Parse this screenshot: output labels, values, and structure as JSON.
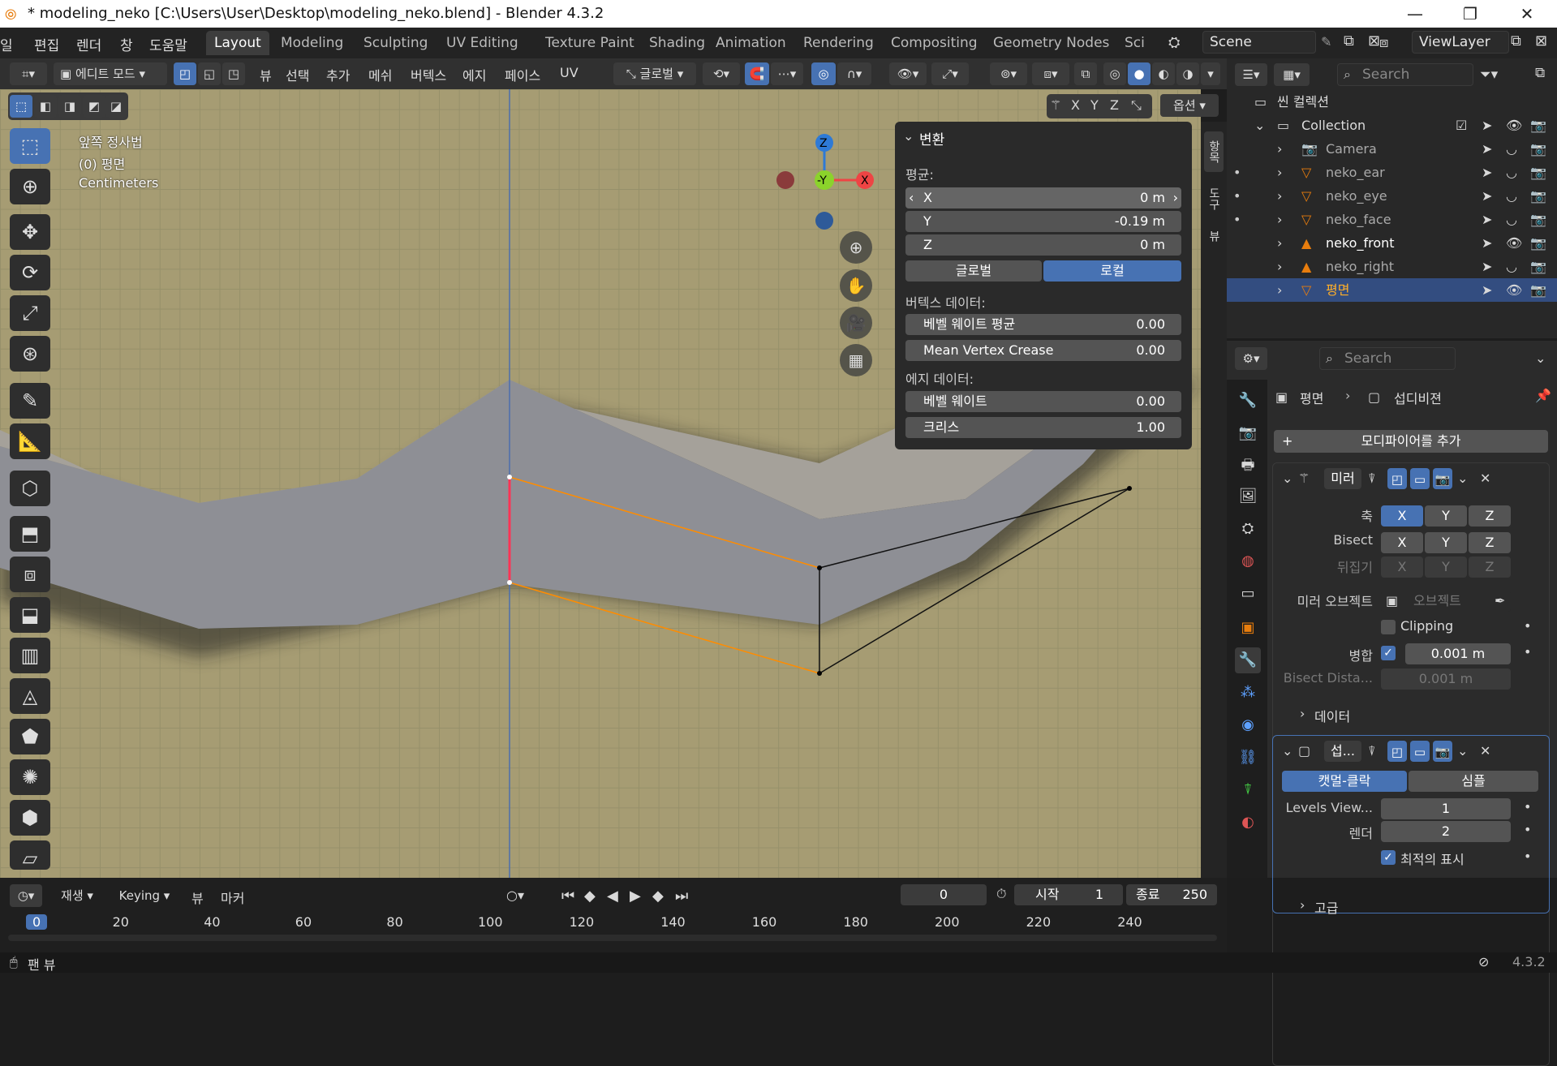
{
  "titlebar": {
    "title": "* modeling_neko [C:\\Users\\User\\Desktop\\modeling_neko.blend] - Blender 4.3.2",
    "minimize": "—",
    "maximize": "❐",
    "close": "✕"
  },
  "menus": [
    "일",
    "편집",
    "렌더",
    "창",
    "도움말"
  ],
  "menus_left": [
    0,
    42,
    94,
    148,
    184
  ],
  "workspaces": [
    "Layout",
    "Modeling",
    "Sculpting",
    "UV Editing",
    "Texture Paint",
    "Shading",
    "Animation",
    "Rendering",
    "Compositing",
    "Geometry Nodes",
    "Sci"
  ],
  "scene": "Scene",
  "view_layer": "ViewLayer",
  "vp_header": {
    "mode": "에디트 모드",
    "menus": [
      "뷰",
      "선택",
      "추가",
      "메쉬",
      "버텍스",
      "에지",
      "페이스",
      "UV"
    ],
    "orientation": "글로벌",
    "options": "옵션",
    "axes": [
      "X",
      "Y",
      "Z"
    ]
  },
  "overlay": {
    "view_name": "앞쪽 정사법",
    "object": "(0) 평면",
    "units": "Centimeters"
  },
  "gizmo": {
    "z": "Z",
    "y": "-Y",
    "x": "X"
  },
  "npanel": {
    "title": "변환",
    "median": "평균:",
    "x_label": "X",
    "x_value": "0 m",
    "y_label": "Y",
    "y_value": "-0.19 m",
    "z_label": "Z",
    "z_value": "0 m",
    "global": "글로벌",
    "local": "로컬",
    "vertex_data": "버텍스 데이터:",
    "bevel_weight_mean": "베벨 웨이트 평균",
    "bevel_weight_mean_value": "0.00",
    "mean_crease": "Mean Vertex Crease",
    "mean_crease_value": "0.00",
    "edge_data": "에지 데이터:",
    "bevel_weight": "베벨 웨이트",
    "bevel_weight_value": "0.00",
    "crease": "크리스",
    "crease_value": "1.00",
    "side_tabs": [
      "항목",
      "도구",
      "뷰"
    ]
  },
  "outliner": {
    "search_placeholder": "Search",
    "scene_collection": "씬 컬렉션",
    "collection": "Collection",
    "items": [
      {
        "name": "Camera",
        "color": "#aaaaaa"
      },
      {
        "name": "neko_ear",
        "color": "#aaaaaa"
      },
      {
        "name": "neko_eye",
        "color": "#aaaaaa"
      },
      {
        "name": "neko_face",
        "color": "#aaaaaa"
      },
      {
        "name": "neko_front",
        "color": "#ffffff"
      },
      {
        "name": "neko_right",
        "color": "#aaaaaa"
      },
      {
        "name": "평면",
        "color": "#ffaf29"
      }
    ]
  },
  "props": {
    "search_placeholder": "Search",
    "breadcrumb_obj": "평면",
    "breadcrumb_mod": "섭디비젼",
    "add_modifier": "모디파이어를 추가",
    "mirror": {
      "name": "미러",
      "axis": "축",
      "bisect": "Bisect",
      "flip": "뒤집기",
      "x": "X",
      "y": "Y",
      "z": "Z",
      "mirror_object": "미러 오브젝트",
      "object_placeholder": "오브젝트",
      "clipping": "Clipping",
      "merge": "병합",
      "merge_value": "0.001 m",
      "bisect_distance": "Bisect Dista...",
      "bisect_distance_value": "0.001 m",
      "data": "데이터"
    },
    "subsurf": {
      "name": "섭...",
      "catmull": "캣멀-클락",
      "simple": "심플",
      "levels_viewport": "Levels View...",
      "levels_viewport_value": "1",
      "render": "렌더",
      "render_value": "2",
      "optimal": "최적의 표시",
      "advanced": "고급"
    }
  },
  "timeline": {
    "playback": "재생",
    "keying": "Keying",
    "view": "뷰",
    "marker": "마커",
    "frame": "0",
    "start_label": "시작",
    "start": "1",
    "end_label": "종료",
    "end": "250",
    "ticks": [
      "0",
      "20",
      "40",
      "60",
      "80",
      "100",
      "120",
      "140",
      "160",
      "180",
      "200",
      "220",
      "240"
    ]
  },
  "status": {
    "pan": "팬 뷰",
    "version": "4.3.2"
  },
  "colors": {
    "accent": "#4772b3",
    "selected_edge": "#ff3355",
    "orange_outline": "#ff8c00"
  }
}
